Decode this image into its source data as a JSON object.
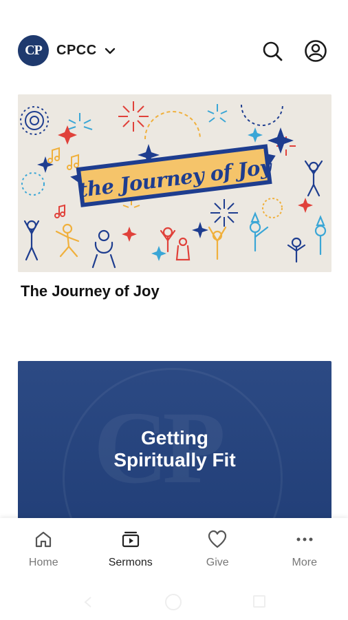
{
  "header": {
    "logo_text": "CP",
    "org_name": "CPCC",
    "icons": {
      "dropdown": "chevron-down-icon",
      "search": "search-icon",
      "profile": "user-circle-icon"
    }
  },
  "cards": [
    {
      "title": "The Journey of Joy",
      "banner_text": "the Journey of Joy"
    },
    {
      "title": "Getting\nSpiritually Fit",
      "watermark": "CP"
    }
  ],
  "bottom_nav": {
    "items": [
      {
        "label": "Home",
        "icon": "home-icon",
        "active": false
      },
      {
        "label": "Sermons",
        "icon": "video-icon",
        "active": true
      },
      {
        "label": "Give",
        "icon": "heart-icon",
        "active": false
      },
      {
        "label": "More",
        "icon": "more-dots-icon",
        "active": false
      }
    ]
  },
  "colors": {
    "navy": "#1f3a6e",
    "card2_bg": "#2c4a84",
    "banner_yellow": "#f5c46a",
    "banner_blue": "#1e3d8f",
    "card1_bg": "#ece8e1"
  }
}
